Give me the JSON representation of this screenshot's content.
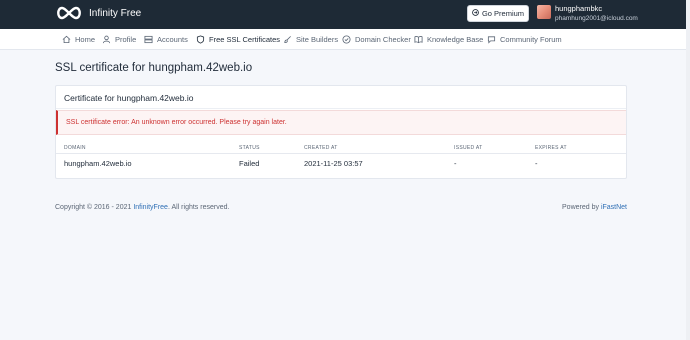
{
  "app": {
    "logo_text": "Infinity Free",
    "brand_color": "#1e2a36",
    "accent": "#2f6fb5",
    "error_color": "#cd3131"
  },
  "header": {
    "premium_button": "Go Premium",
    "user": {
      "name": "hungphambkc",
      "email": "phamhung2001@icloud.com"
    }
  },
  "nav": {
    "items": [
      {
        "label": "Home",
        "icon": "home-icon"
      },
      {
        "label": "Profile",
        "icon": "user-icon"
      },
      {
        "label": "Accounts",
        "icon": "server-icon"
      },
      {
        "label": "Free SSL Certificates",
        "icon": "shield-icon",
        "active": true
      },
      {
        "label": "Site Builders",
        "icon": "brush-icon"
      },
      {
        "label": "Domain Checker",
        "icon": "check-circle-icon"
      },
      {
        "label": "Knowledge Base",
        "icon": "book-icon"
      },
      {
        "label": "Community Forum",
        "icon": "chat-icon"
      }
    ]
  },
  "main": {
    "page_title": "SSL certificate for hungpham.42web.io",
    "card_title": "Certificate for hungpham.42web.io",
    "alert": "SSL certificate error: An unknown error occurred. Please try again later.",
    "table": {
      "headers": [
        "DOMAIN",
        "STATUS",
        "CREATED AT",
        "ISSUED AT",
        "EXPIRES AT"
      ],
      "rows": [
        [
          "hungpham.42web.io",
          "Failed",
          "2021-11-25 03:57",
          "-",
          "-"
        ]
      ]
    }
  },
  "footer": {
    "copyright_prefix": "Copyright © 2016 - 2021",
    "copyright_link": "InfinityFree",
    "copyright_suffix": ". All rights reserved.",
    "powered_prefix": "Powered by",
    "powered_link": "iFastNet"
  }
}
